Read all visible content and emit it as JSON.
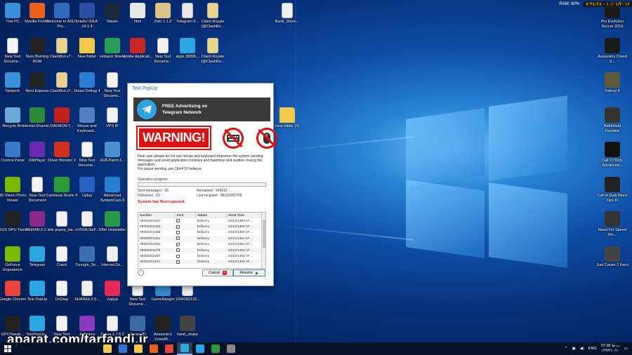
{
  "status_bar": {
    "clock": "۷:۳۸:۴۸ - ۱۰/۰۱/۲۰۱۶",
    "ram": "RAM: 60%"
  },
  "desktop_icons": [
    {
      "label": "This PC",
      "icon": "this-pc-icon",
      "color": "#3b8fd8"
    },
    {
      "label": "Mozilla Firefox",
      "icon": "firefox-icon",
      "color": "#e8621d"
    },
    {
      "label": "Welcome to ASUS Pro...",
      "icon": "asus-icon",
      "color": "#2f6ac0"
    },
    {
      "label": "IntelliJ IDEA 14.1.4",
      "icon": "intellij-icon",
      "color": "#2b4fa0"
    },
    {
      "label": "Steam",
      "icon": "steam-icon",
      "color": "#1b2838"
    },
    {
      "label": "html",
      "icon": "html-file-icon",
      "color": "#e7e7e7"
    },
    {
      "label": "Zekr 1.1.0",
      "icon": "zekr-icon",
      "color": "#d8c48a"
    },
    {
      "label": "Telegram-F...",
      "icon": "file-icon",
      "color": "#e7e7e7"
    },
    {
      "label": "Clash Royale (@ClashRo...",
      "icon": "file-icon",
      "color": "#e8d48a"
    },
    {
      "label": "Bank_Shom...",
      "icon": "file-icon",
      "color": "#f0f0f0"
    },
    {
      "label": "Pro Evolution Soccer 2016",
      "icon": "pes-icon",
      "color": "#1a1a1a"
    },
    {
      "label": "New Text Docume...",
      "icon": "text-file-icon",
      "color": "#f4f4f4"
    },
    {
      "label": "Nero Burning ROM",
      "icon": "nero-icon",
      "color": "#222"
    },
    {
      "label": "ClashBot.v7...",
      "icon": "file-icon",
      "color": "#e8d48a"
    },
    {
      "label": "New folder",
      "icon": "folder-icon",
      "color": "#f2c94c"
    },
    {
      "label": "Hotspot Shield",
      "icon": "hotspot-icon",
      "color": "#2a9d5c"
    },
    {
      "label": "Adobe Applicati...",
      "icon": "adobe-icon",
      "color": "#c62828"
    },
    {
      "label": "New Text Docume...",
      "icon": "text-file-icon",
      "color": "#f4f4f4"
    },
    {
      "label": "apps.38995...",
      "icon": "telegram-icon",
      "color": "#2ca5e0"
    },
    {
      "label": "Clash Royale (@ClashRo...",
      "icon": "file-icon",
      "color": "#e8d48a"
    },
    {
      "label": "Assassins Creed S...",
      "icon": "assassins-icon",
      "color": "#1a1a1a"
    },
    {
      "label": "Network",
      "icon": "network-icon",
      "color": "#3b8fd8"
    },
    {
      "label": "Nero Express",
      "icon": "nero-icon",
      "color": "#222"
    },
    {
      "label": "ClashBot.v7...",
      "icon": "file-icon",
      "color": "#e8d48a"
    },
    {
      "label": "Smart Defrag 4",
      "icon": "defrag-icon",
      "color": "#2a7fd4"
    },
    {
      "label": "New Text Docume...",
      "icon": "text-file-icon",
      "color": "#f4f4f4"
    },
    {
      "label": "Fallout 4",
      "icon": "fallout-icon",
      "color": "#5a5a3a"
    },
    {
      "label": "Recycle Bin",
      "icon": "recycle-bin-icon",
      "color": "#6aa8d8"
    },
    {
      "label": "Internet Downlo...",
      "icon": "idm-icon",
      "color": "#2a8a3a"
    },
    {
      "label": "DAEMON T...",
      "icon": "daemon-icon",
      "color": "#c02020"
    },
    {
      "label": "Mouse and Keyboard...",
      "icon": "mouse-keyboard-icon",
      "color": "#5080c0"
    },
    {
      "label": "VPS IP",
      "icon": "text-file-icon",
      "color": "#f4f4f4"
    },
    {
      "label": "New folder (2)",
      "icon": "folder-icon",
      "color": "#f2c94c"
    },
    {
      "label": "Battlefield Hardline",
      "icon": "battlefield-icon",
      "color": "#333"
    },
    {
      "label": "Control Panel",
      "icon": "control-panel-icon",
      "color": "#3a7ac8"
    },
    {
      "label": "KMPlayer",
      "icon": "kmplayer-icon",
      "color": "#6a2ab0"
    },
    {
      "label": "Driver Booster 3",
      "icon": "driver-booster-icon",
      "color": "#d03020"
    },
    {
      "label": "New Text Docume...",
      "icon": "text-file-icon",
      "color": "#f4f4f4"
    },
    {
      "label": "4GB.Patch.1...",
      "icon": "patch-icon",
      "color": "#4a90d0"
    },
    {
      "label": "Call Of Duty Advanced...",
      "icon": "cod-icon",
      "color": "#111"
    },
    {
      "label": "3D Vision Photo Viewer",
      "icon": "nvidia-3d-icon",
      "color": "#76b900"
    },
    {
      "label": "New Text Document",
      "icon": "text-file-icon",
      "color": "#f4f4f4"
    },
    {
      "label": "Camtasia Studio 8",
      "icon": "camtasia-icon",
      "color": "#2a9a3a"
    },
    {
      "label": "Uplay",
      "icon": "uplay-icon",
      "color": "#2a60c0"
    },
    {
      "label": "Advanced SystemCare 8",
      "icon": "systemcare-icon",
      "color": "#2a80d0"
    },
    {
      "label": "Call of Duty Black Ops III",
      "icon": "cod-icon",
      "color": "#222"
    },
    {
      "label": "ASUS GPU Tweak",
      "icon": "gpu-tweak-icon",
      "color": "#222"
    },
    {
      "label": "WinRAR.5.2...",
      "icon": "winrar-icon",
      "color": "#8a2a8a"
    },
    {
      "label": "tele popup_wa...",
      "icon": "file-icon",
      "color": "#f0f0f0"
    },
    {
      "label": "nVIDIA.GeF...",
      "icon": "file-icon",
      "color": "#f0f0f0"
    },
    {
      "label": "IObit Uninstaller",
      "icon": "iobit-icon",
      "color": "#2a9a4a"
    },
    {
      "label": "Need For Speed Riv...",
      "icon": "nfs-icon",
      "color": "#333"
    },
    {
      "label": "GeForce Experience",
      "icon": "geforce-icon",
      "color": "#76b900"
    },
    {
      "label": "Telegram",
      "icon": "telegram-icon",
      "color": "#2ca5e0"
    },
    {
      "label": "Crack",
      "icon": "text-file-icon",
      "color": "#f4f4f4"
    },
    {
      "label": "Tunngle_Se...",
      "icon": "tunngle-icon",
      "color": "#3a70b0"
    },
    {
      "label": "Internet.Do...",
      "icon": "file-icon",
      "color": "#f0f0f0"
    },
    {
      "label": "Just Cause 2 Farsi",
      "icon": "just-cause-icon",
      "color": "#444"
    },
    {
      "label": "Google Chrome",
      "icon": "chrome-icon",
      "color": "#e8453c"
    },
    {
      "label": "Tele PopUp",
      "icon": "telegram-icon",
      "color": "#2ca5e0"
    },
    {
      "label": "DxDiag",
      "icon": "text-file-icon",
      "color": "#f4f4f4"
    },
    {
      "label": "SHAREit.2.5...",
      "icon": "file-icon",
      "color": "#f0f0f0"
    },
    {
      "label": "Zapya",
      "icon": "zapya-icon",
      "color": "#e82a5a"
    },
    {
      "label": "New Text Docume...",
      "icon": "text-file-icon",
      "color": "#f4f4f4"
    },
    {
      "label": "GameRanger",
      "icon": "gameranger-icon",
      "color": "#3a8ad0"
    },
    {
      "label": "1394182110...",
      "icon": "file-icon",
      "color": "#f0f0f0"
    },
    {
      "label": "GPUTweak...",
      "icon": "gpu-tweak-icon",
      "color": "#222"
    },
    {
      "label": "TelePopUp...",
      "icon": "telegram-icon",
      "color": "#2ca5e0"
    },
    {
      "label": "New Text Docume...",
      "icon": "text-file-icon",
      "color": "#f4f4f4"
    },
    {
      "label": "JetBrains PhpStor...",
      "icon": "phpstorm-icon",
      "color": "#8a3ac0"
    },
    {
      "label": "Zapya.1.7.6.2 Final",
      "icon": "file-icon",
      "color": "#f0f0f0"
    },
    {
      "label": "Quran 3D",
      "icon": "quran-icon",
      "color": "#3a6aa0"
    },
    {
      "label": "Assassin's Creed®...",
      "icon": "assassins-icon",
      "color": "#222"
    },
    {
      "label": "hand_shake",
      "icon": "hand-shake-icon",
      "color": "#444"
    }
  ],
  "dialog": {
    "title": "Tele PopUp",
    "banner_line1": "FREE Advertising on",
    "banner_line2": "Telegram Network",
    "warning": "WARNING!",
    "message": "Dear user please do not use mouse and keyboard whenever the system sending messages and avoid application minimize and maximize and sudden closing the application.",
    "message_hint": "For pause sending use Ctrl+F10 hotkeys.",
    "operation_label": "Operation progress:",
    "progress": 0.0,
    "sent_messages": "Sent messages : 65",
    "deliveries": "Deliveries : 63",
    "remained": "Remained : 943615",
    "last_recipient": "Last recipient : 09102002756",
    "paused_text": "System has Been paused.",
    "columns": [
      "Number",
      "Sent",
      "Status",
      "Send Time"
    ],
    "rows": [
      {
        "number": "09302001007",
        "status": "Delivery",
        "time": "10/10/1394 07:..."
      },
      {
        "number": "09302001043",
        "status": "Delivery",
        "time": "10/10/1394 07:..."
      },
      {
        "number": "09302001048",
        "status": "Delivery",
        "time": "10/10/1394 07:..."
      },
      {
        "number": "09302001051",
        "status": "Delivery",
        "time": "10/10/1394 07:..."
      },
      {
        "number": "09302001052",
        "status": "Delivery",
        "time": "10/10/1394 07:..."
      },
      {
        "number": "09302001075",
        "status": "Delivery",
        "time": "10/10/1394 07:..."
      },
      {
        "number": "09302001087",
        "status": "Delivery",
        "time": "10/10/1394 07:..."
      },
      {
        "number": "09302001104",
        "status": "Delivery",
        "time": "10/10/1394 07:..."
      }
    ],
    "cancel_label": "Cancel",
    "resume_label": "Resume"
  },
  "taskbar": {
    "items": [
      "file-explorer-icon",
      "edge-icon",
      "file-explorer-icon",
      "firefox-icon",
      "chrome-icon",
      "tele-popup-icon",
      "telegram-icon",
      "camtasia-icon",
      "media-icon"
    ],
    "lang": "ENG",
    "time": "07:38 ب.ظ",
    "date": "۱۳۹۴/۱۰/۱۰"
  },
  "watermark": "aparat.com/tarfandi.ir"
}
